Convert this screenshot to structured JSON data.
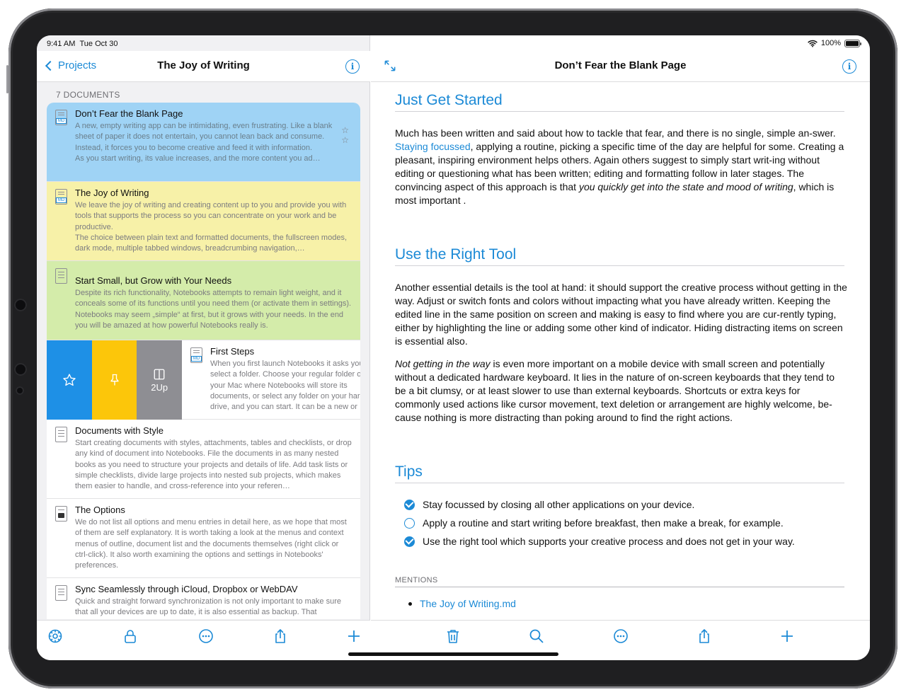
{
  "status_bar": {
    "time": "9:41 AM",
    "date": "Tue Oct 30",
    "battery": "100%"
  },
  "left_nav": {
    "back_label": "Projects",
    "title": "The Joy of Writing"
  },
  "document_list": {
    "section_header": "7 DOCUMENTS",
    "items": [
      {
        "title": "Don’t Fear the Blank Page",
        "body": "A new, empty writing app can be intimidating, even frustrating. Like a blank sheet of paper it does not entertain, you cannot lean back and consume. Instead, it forces you to become creative and feed it with information.\nAs you start writing, its value increases, and the more content you ad…",
        "badge": "MD",
        "color": "#9fd3f5"
      },
      {
        "title": "The Joy of Writing",
        "body": "We leave the joy of writing and creating content up to you and provide you with tools that supports the process so you can concentrate on your work and be productive.\nThe choice between plain text and formatted documents, the fullscreen modes, dark mode, multiple tabbed windows, breadcrumbing navigation,…",
        "badge": "MD",
        "color": "#f7f1a8"
      },
      {
        "title": "Start Small, but Grow with Your Needs",
        "body": "Despite its rich functionality, Notebooks attempts to remain light weight, and it conceals some of its functions until you need them (or activate them in settings). Notebooks may seem „simple“ at first, but it grows with your needs. In the end you will be amazed at how powerful Notebooks really is.",
        "badge": "",
        "color": "#d4ecaa"
      },
      {
        "title": "First Steps",
        "body": "When you first launch Notebooks it asks you to select a folder. Choose your regular folder on your Mac where Notebooks will store its documents, or select any folder on your hard drive, and you can start. It can be a new or empty one. It is okay to pick a folder with your existing documents, like the folder you were using",
        "badge": "MD",
        "color": "#ffffff"
      },
      {
        "title": "Documents with Style",
        "body": "Start creating documents with styles, attachments, tables and checklists, or drop any kind of document into Notebooks. File the documents in as many nested books as you need to structure your projects and details of life. Add task lists or simple checklists, divide large projects into nested sub projects, which makes them easier to handle, and cross-reference into your referen…",
        "badge": "",
        "color": "#ffffff"
      },
      {
        "title": "The Options",
        "body": "We do not list all options and menu entries in detail here, as we hope that most of them are self explanatory. It is worth taking a look at the menus and context menus of outline, document list and the documents themselves (right click or ctrl-click). It also worth examining the options and settings in Notebooks' preferences.",
        "badge": "",
        "color": "#ffffff"
      },
      {
        "title": "Sync Seamlessly through iCloud, Dropbox or WebDAV",
        "body": "Quick and straight forward synchronization is not only important to make sure that all your devices are up to date, it is also essential as backup. That",
        "badge": "",
        "color": "#ffffff"
      }
    ],
    "swipe_actions": {
      "favorite_color": "#1e90e6",
      "pin_color": "#fcc60a",
      "two_up_color": "#8e8e93",
      "two_up_label": "2Up"
    },
    "side_marks": "☆\n☆"
  },
  "right_nav": {
    "title": "Don’t Fear the Blank Page"
  },
  "document": {
    "h1": "Just Get Started",
    "p1_a": "Much has been written and said about how to tackle that fear, and there is no single, simple an-swer. ",
    "p1_link": "Staying focussed",
    "p1_b": ", applying a routine, picking a specific time of the day are helpful for some. Creating a pleasant, inspiring environment helps others. Again others suggest to simply start writ-ing without editing or questioning what has been written; editing and formatting follow in later stages. The convincing aspect of this approach is that ",
    "p1_em": "you quickly get into the state and mood of writing",
    "p1_c": ", which is most important .",
    "h2": "Use the Right Tool",
    "p2": "Another essential details is the tool at hand: it should support the creative process without getting in the way. Adjust or switch fonts and colors without impacting what you have already written. Keeping the edited line in the same position on screen and making is easy to find where you are cur-rently typing, either by highlighting the line or adding some other kind of indicator. Hiding distracting items on screen is essential also.",
    "p3_em": "Not getting in the way",
    "p3_b": " is even more important on a mobile device with small screen and potentially without a dedicated hardware keyboard. It lies in the nature of on-screen keyboards that they tend to be a bit clumsy, or at least slower to use than external keyboards. Shortcuts or extra keys for commonly used actions like cursor movement, text deletion or arrangement are highly welcome, be-cause nothing is more distracting than poking around to find the right actions.",
    "h3": "Tips",
    "tips": [
      {
        "text": "Stay focussed by closing all other applications on your device.",
        "done": true
      },
      {
        "text": "Apply a routine and start writing before breakfast, then make a break, for example.",
        "done": false
      },
      {
        "text": "Use the right tool which supports your creative process and does not get in your way.",
        "done": true
      }
    ],
    "mentions_header": "MENTIONS",
    "mention": "The Joy of Writing.md"
  },
  "colors": {
    "accent": "#1c8ad6"
  }
}
